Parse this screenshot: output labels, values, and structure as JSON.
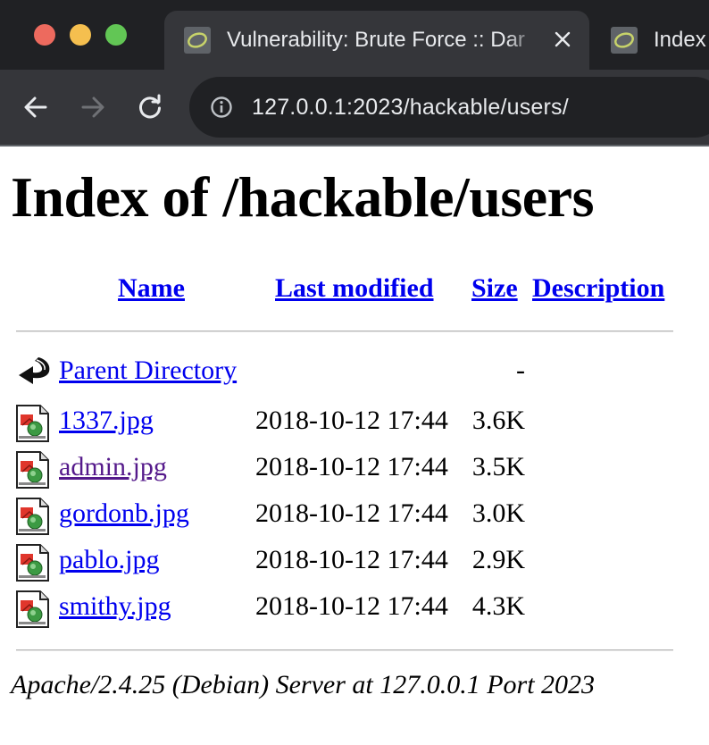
{
  "browser": {
    "tabs": [
      {
        "title": "Vulnerability: Brute Force :: Dar",
        "active": true
      },
      {
        "title": "Index",
        "active": false
      }
    ],
    "address": "127.0.0.1:2023/hackable/users/"
  },
  "page": {
    "heading": "Index of /hackable/users",
    "columns": {
      "name": "Name",
      "last_modified": "Last modified",
      "size": "Size",
      "description": "Description"
    },
    "parent": {
      "name": "Parent Directory",
      "size": "-"
    },
    "files": [
      {
        "name": "1337.jpg",
        "modified": "2018-10-12 17:44",
        "size": "3.6K",
        "visited": false
      },
      {
        "name": "admin.jpg",
        "modified": "2018-10-12 17:44",
        "size": "3.5K",
        "visited": true
      },
      {
        "name": "gordonb.jpg",
        "modified": "2018-10-12 17:44",
        "size": "3.0K",
        "visited": false
      },
      {
        "name": "pablo.jpg",
        "modified": "2018-10-12 17:44",
        "size": "2.9K",
        "visited": false
      },
      {
        "name": "smithy.jpg",
        "modified": "2018-10-12 17:44",
        "size": "4.3K",
        "visited": false
      }
    ],
    "footer": "Apache/2.4.25 (Debian) Server at 127.0.0.1 Port 2023"
  },
  "colors": {
    "link": "#0000ee",
    "visited_link": "#551a8b",
    "chrome_dark": "#202124",
    "chrome_toolbar": "#35363a"
  },
  "icons": {
    "parent": "back-arrow-icon",
    "file": "image-file-icon"
  }
}
